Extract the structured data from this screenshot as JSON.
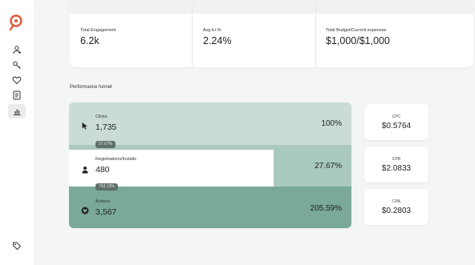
{
  "sidebar": {
    "logo": "search-logo",
    "items": [
      {
        "icon": "user-icon"
      },
      {
        "icon": "key-icon"
      },
      {
        "icon": "heart-icon"
      },
      {
        "icon": "document-icon"
      },
      {
        "icon": "bar-chart-icon",
        "active": true
      }
    ],
    "bottom_icon": "tag-icon"
  },
  "stats": [
    {
      "label": "Total Engagement",
      "value": "6.2k"
    },
    {
      "label": "Avg Er.%",
      "value": "2.24%"
    },
    {
      "label": "Total Budget/Current expenses",
      "value": "$1,000/$1,000"
    }
  ],
  "funnel": {
    "title": "Performance funnel",
    "stages": [
      {
        "name": "Clicks",
        "value": "1,735",
        "percent": "100%",
        "icon": "cursor-icon"
      },
      {
        "name": "Registrations/Installs",
        "value": "480",
        "percent": "27.67%",
        "icon": "person-icon"
      },
      {
        "name": "Actions",
        "value": "3,567",
        "percent": "205.59%",
        "icon": "heart-icon"
      }
    ],
    "conversions": [
      "27.67%",
      "743.13%"
    ]
  },
  "metrics": [
    {
      "label": "CPC",
      "value": "$0.5764"
    },
    {
      "label": "CPR",
      "value": "$2.0833"
    },
    {
      "label": "CPA",
      "value": "$0.2803"
    }
  ],
  "colors": {
    "accent": "#e05a3a",
    "funnel_light": "#cbdcd8",
    "funnel_mid": "#a9c9bf",
    "funnel_dark": "#7aa998"
  }
}
